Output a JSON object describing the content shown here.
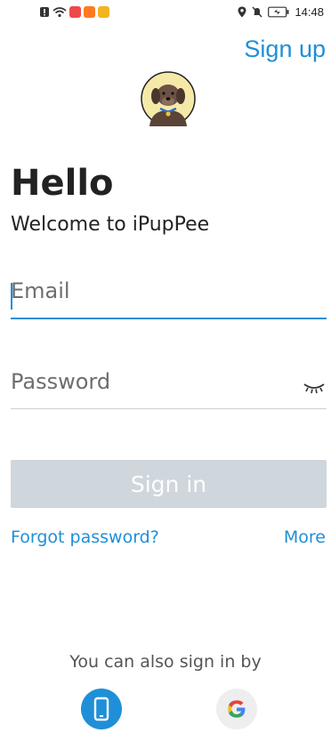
{
  "status_bar": {
    "time": "14:48",
    "icons": [
      "alert-icon",
      "wifi-icon",
      "red-app-icon",
      "orange-app-icon",
      "yellow-app-icon",
      "location-icon",
      "mute-icon",
      "battery-icon"
    ]
  },
  "header": {
    "signup_label": "Sign up"
  },
  "logo": {
    "icon": "puppy-logo-icon"
  },
  "greeting": {
    "title": "Hello",
    "subtitle": "Welcome to iPupPee"
  },
  "form": {
    "email_placeholder": "Email",
    "email_value": "",
    "password_placeholder": "Password",
    "password_value": "",
    "signin_label": "Sign in"
  },
  "links": {
    "forgot_label": "Forgot password?",
    "more_label": "More"
  },
  "alt_signin": {
    "text": "You can also sign in by",
    "options": [
      "phone-icon",
      "google-icon"
    ]
  },
  "colors": {
    "accent": "#1f8fd8",
    "button_disabled": "#cfd6dc"
  }
}
